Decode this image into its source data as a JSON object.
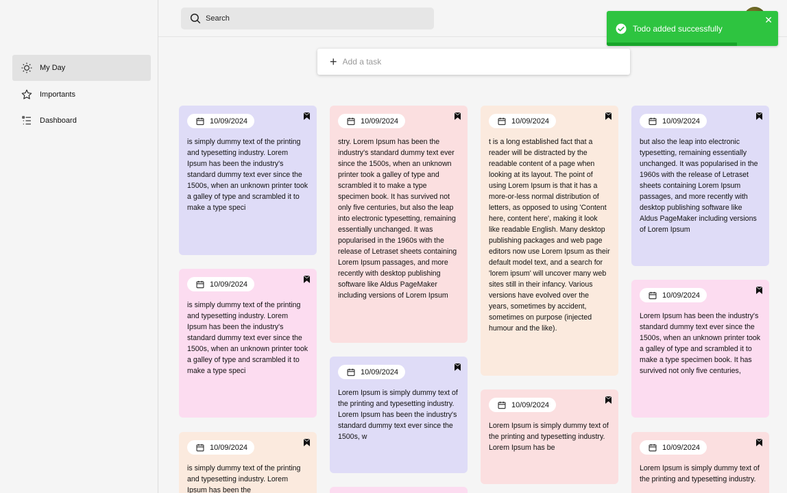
{
  "sidebar": {
    "items": [
      {
        "label": "My Day",
        "icon": "sun-icon",
        "active": true
      },
      {
        "label": "Importants",
        "icon": "star-icon",
        "active": false
      },
      {
        "label": "Dashboard",
        "icon": "list-icon",
        "active": false
      }
    ]
  },
  "header": {
    "search_placeholder": "Search"
  },
  "toast": {
    "message": "Todo added successfully",
    "icon": "check-circle-icon",
    "close": "✕",
    "progress": 0.76
  },
  "add_task": {
    "placeholder": "Add a task"
  },
  "colors": {
    "purple": "#dfdcf7",
    "pink": "#fcdcf0",
    "rose": "#fbdfe0",
    "peach": "#fbeade",
    "toast": "#2ec440"
  },
  "cards": [
    {
      "date": "10/09/2024",
      "color": "purple",
      "text": "is simply dummy text of the printing and typesetting industry. Lorem Ipsum has been the industry's standard dummy text ever since the 1500s, when an unknown printer took a galley of type and scrambled it to make a type speci"
    },
    {
      "date": "10/09/2024",
      "color": "pink",
      "text": "is simply dummy text of the printing and typesetting industry. Lorem Ipsum has been the industry's standard dummy text ever since the 1500s, when an unknown printer took a galley of type and scrambled it to make a type speci"
    },
    {
      "date": "10/09/2024",
      "color": "peach",
      "text": "is simply dummy text of the printing and typesetting industry. Lorem Ipsum has been the"
    },
    {
      "date": "10/09/2024",
      "color": "rose",
      "text": "stry. Lorem Ipsum has been the industry's standard dummy text ever since the 1500s, when an unknown printer took a galley of type and scrambled it to make a type specimen book. It has survived not only five centuries, but also the leap into electronic typesetting, remaining essentially unchanged. It was popularised in the 1960s with the release of Letraset sheets containing Lorem Ipsum passages, and more recently with desktop publishing software like Aldus PageMaker including versions of Lorem Ipsum"
    },
    {
      "date": "10/09/2024",
      "color": "purple",
      "text": "Lorem Ipsum is simply dummy text of the printing and typesetting industry. Lorem Ipsum has been the industry's standard dummy text ever since the 1500s, w"
    },
    {
      "date": "10/09/2024",
      "color": "peach",
      "text": "t is a long established fact that a reader will be distracted by the readable content of a page when looking at its layout. The point of using Lorem Ipsum is that it has a more-or-less normal distribution of letters, as opposed to using 'Content here, content here', making it look like readable English. Many desktop publishing packages and web page editors now use Lorem Ipsum as their default model text, and a search for 'lorem ipsum' will uncover many web sites still in their infancy. Various versions have evolved over the years, sometimes by accident, sometimes on purpose (injected humour and the like)."
    },
    {
      "date": "10/09/2024",
      "color": "rose",
      "text": "Lorem Ipsum is simply dummy text of the printing and typesetting industry. Lorem Ipsum has be"
    },
    {
      "date": "10/09/2024",
      "color": "purple",
      "text": "but also the leap into electronic typesetting, remaining essentially unchanged. It was popularised in the 1960s with the release of Letraset sheets containing Lorem Ipsum passages, and more recently with desktop publishing software like Aldus PageMaker including versions of Lorem Ipsum"
    },
    {
      "date": "10/09/2024",
      "color": "pink",
      "text": "Lorem Ipsum has been the industry's standard dummy text ever since the 1500s, when an unknown printer took a galley of type and scrambled it to make a type specimen book. It has survived not only five centuries,"
    },
    {
      "date": "10/09/2024",
      "color": "rose",
      "text": "Lorem Ipsum is simply dummy text of the printing and typesetting industry."
    }
  ]
}
